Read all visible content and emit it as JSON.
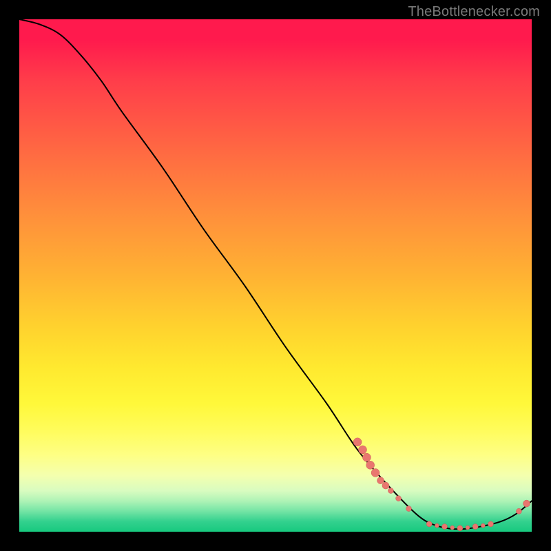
{
  "watermark": "TheBottlenecker.com",
  "colors": {
    "curve": "#000000",
    "dot_fill": "#e9766f",
    "dot_stroke": "#c85a54"
  },
  "chart_data": {
    "type": "line",
    "title": "",
    "xlabel": "",
    "ylabel": "",
    "xlim": [
      0,
      100
    ],
    "ylim": [
      0,
      100
    ],
    "grid": false,
    "curve": [
      {
        "x": 0,
        "y": 100
      },
      {
        "x": 4,
        "y": 99
      },
      {
        "x": 8,
        "y": 97
      },
      {
        "x": 12,
        "y": 93
      },
      {
        "x": 16,
        "y": 88
      },
      {
        "x": 20,
        "y": 82
      },
      {
        "x": 28,
        "y": 71
      },
      {
        "x": 36,
        "y": 59
      },
      {
        "x": 44,
        "y": 48
      },
      {
        "x": 52,
        "y": 36
      },
      {
        "x": 60,
        "y": 25
      },
      {
        "x": 66,
        "y": 16
      },
      {
        "x": 72,
        "y": 9
      },
      {
        "x": 78,
        "y": 3
      },
      {
        "x": 82,
        "y": 1
      },
      {
        "x": 86,
        "y": 0.5
      },
      {
        "x": 90,
        "y": 1
      },
      {
        "x": 94,
        "y": 2
      },
      {
        "x": 97,
        "y": 3.5
      },
      {
        "x": 100,
        "y": 6
      }
    ],
    "scatter": [
      {
        "x": 66,
        "y": 17.5,
        "r": 6
      },
      {
        "x": 67,
        "y": 16,
        "r": 6
      },
      {
        "x": 67.8,
        "y": 14.5,
        "r": 6
      },
      {
        "x": 68.5,
        "y": 13,
        "r": 6
      },
      {
        "x": 69.5,
        "y": 11.5,
        "r": 6
      },
      {
        "x": 70.5,
        "y": 10,
        "r": 5
      },
      {
        "x": 71.5,
        "y": 9,
        "r": 5
      },
      {
        "x": 72.5,
        "y": 8,
        "r": 4
      },
      {
        "x": 74,
        "y": 6.5,
        "r": 4
      },
      {
        "x": 76,
        "y": 4.5,
        "r": 4
      },
      {
        "x": 80,
        "y": 1.5,
        "r": 4
      },
      {
        "x": 81.5,
        "y": 1.2,
        "r": 3
      },
      {
        "x": 83,
        "y": 1,
        "r": 4
      },
      {
        "x": 84.5,
        "y": 0.8,
        "r": 3
      },
      {
        "x": 86,
        "y": 0.7,
        "r": 4
      },
      {
        "x": 87.5,
        "y": 0.8,
        "r": 3
      },
      {
        "x": 89,
        "y": 1,
        "r": 4
      },
      {
        "x": 90.5,
        "y": 1.2,
        "r": 3
      },
      {
        "x": 92,
        "y": 1.5,
        "r": 4
      },
      {
        "x": 97.5,
        "y": 4,
        "r": 4
      },
      {
        "x": 99,
        "y": 5.5,
        "r": 5
      }
    ]
  }
}
